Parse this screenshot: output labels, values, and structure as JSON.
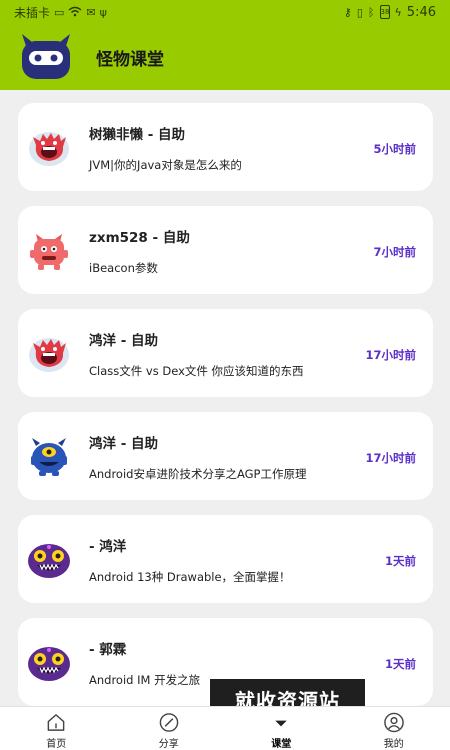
{
  "status_bar": {
    "carrier": "未插卡",
    "time": "5:46",
    "battery_level": "38"
  },
  "header": {
    "title": "怪物课堂",
    "logo_icon": "monster-logo-icon",
    "accent_color": "#99cc00"
  },
  "feed": {
    "items": [
      {
        "author": "树獭非懒 - 自助",
        "title": "JVM|你的Java对象是怎么来的",
        "time": "5小时前",
        "avatar": "red-monster-avatar"
      },
      {
        "author": "zxm528 - 自助",
        "title": "iBeacon参数",
        "time": "7小时前",
        "avatar": "pink-monster-avatar"
      },
      {
        "author": "鸿洋 - 自助",
        "title": "Class文件 vs Dex文件 你应该知道的东西",
        "time": "17小时前",
        "avatar": "red-monster-avatar"
      },
      {
        "author": "鸿洋 - 自助",
        "title": "Android安卓进阶技术分享之AGP工作原理",
        "time": "17小时前",
        "avatar": "blue-monster-avatar"
      },
      {
        "author": " - 鸿洋",
        "title": "Android 13种 Drawable，全面掌握！",
        "time": "1天前",
        "avatar": "purple-monster-avatar"
      },
      {
        "author": " - 郭霖",
        "title": "Android IM 开发之旅",
        "time": "1天前",
        "avatar": "purple-monster-avatar"
      }
    ],
    "time_color": "#5b2fc9"
  },
  "watermark": {
    "text": "就收资源站"
  },
  "bottom_nav": {
    "items": [
      {
        "label": "首页",
        "icon": "home-icon"
      },
      {
        "label": "分享",
        "icon": "compass-icon"
      },
      {
        "label": "课堂",
        "icon": "classroom-icon"
      },
      {
        "label": "我的",
        "icon": "profile-icon"
      }
    ],
    "active_index": 2
  }
}
